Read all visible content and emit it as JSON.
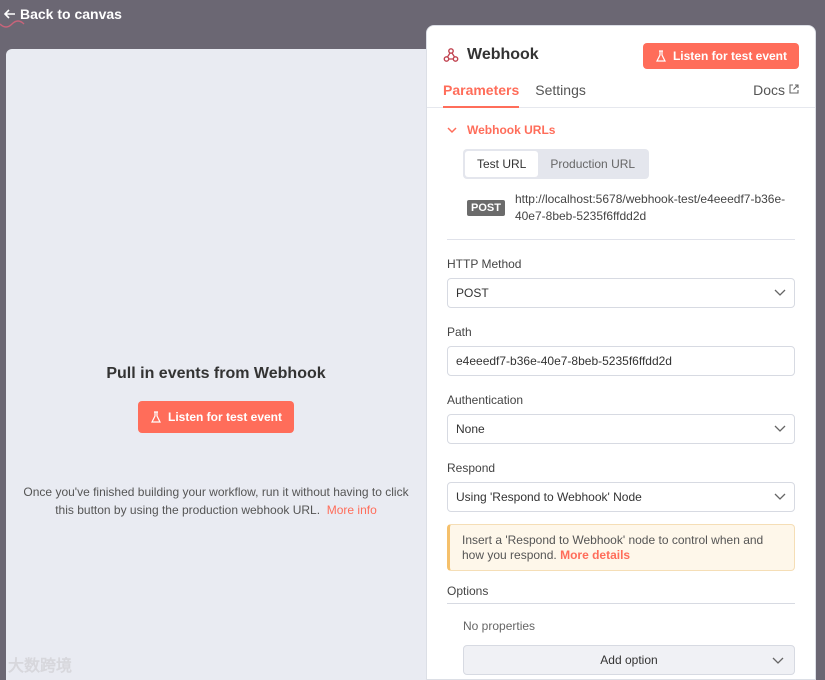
{
  "topbar": {
    "back_label": "Back to canvas"
  },
  "left": {
    "title": "Pull in events from Webhook",
    "listen_button": "Listen for test event",
    "hint_text": "Once you've finished building your workflow, run it without having to click this button by using the production webhook URL.",
    "more_info": "More info"
  },
  "panel": {
    "node_name": "Webhook",
    "listen_button": "Listen for test event",
    "tabs": [
      {
        "label": "Parameters",
        "active": true
      },
      {
        "label": "Settings",
        "active": false
      }
    ],
    "docs_label": "Docs",
    "webhook_urls": {
      "heading": "Webhook URLs",
      "test_url_label": "Test URL",
      "production_url_label": "Production URL",
      "method_badge": "POST",
      "url": "http://localhost:5678/webhook-test/e4eeedf7-b36e-40e7-8beb-5235f6ffdd2d"
    },
    "http_method": {
      "label": "HTTP Method",
      "value": "POST"
    },
    "path": {
      "label": "Path",
      "value": "e4eeedf7-b36e-40e7-8beb-5235f6ffdd2d"
    },
    "authentication": {
      "label": "Authentication",
      "value": "None"
    },
    "respond": {
      "label": "Respond",
      "value": "Using 'Respond to Webhook' Node"
    },
    "notice": {
      "text": "Insert a 'Respond to Webhook' node to control when and how you respond.",
      "link": "More details"
    },
    "options": {
      "label": "Options",
      "empty_text": "No properties",
      "add_button": "Add option"
    }
  },
  "watermark": "大数跨境",
  "colors": {
    "accent": "#ff6d5a",
    "backdrop": "#6b6773",
    "left_pane": "#e9ebf2"
  }
}
